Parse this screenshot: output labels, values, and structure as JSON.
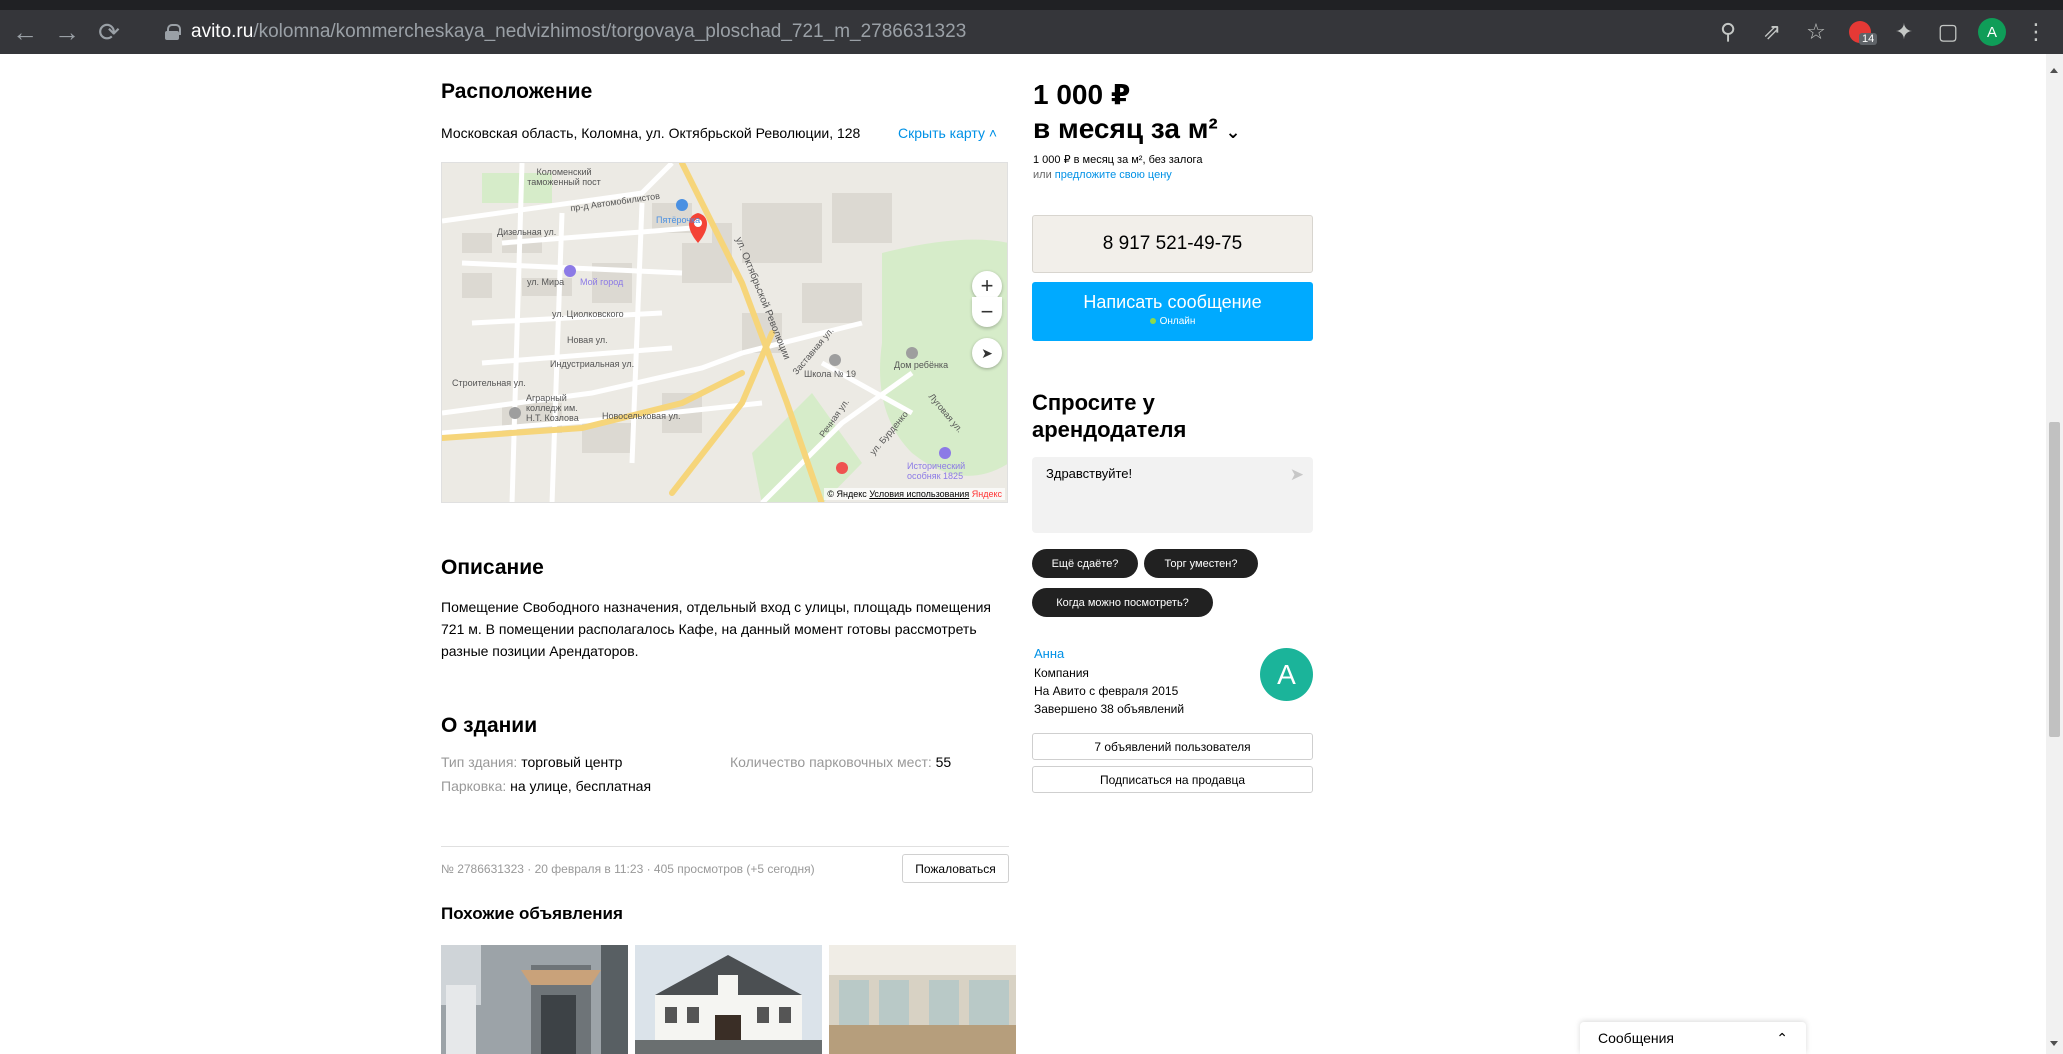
{
  "browser": {
    "url_host": "avito.ru",
    "url_path": "/kolomna/kommercheskaya_nedvizhimost/torgovaya_ploschad_721_m_2786631323",
    "extension_badge": "14",
    "profile_initial": "A"
  },
  "location": {
    "heading": "Расположение",
    "address": "Московская область, Коломна, ул. Октябрьской Революции, 128",
    "hide_map": "Скрыть карту",
    "map_labels": {
      "customs": "Коломенский таможенный пост",
      "pyaterochka": "Пятёрочка",
      "my_city": "Мой город",
      "school": "Школа № 19",
      "children_home": "Дом ребёнка",
      "college": "Аграрный колледж им. Н.Т. Козлова",
      "historic": "Исторический особняк 1825",
      "oct_rev": "ул. Октябрьской Революции",
      "street_mira": "ул. Мира",
      "street_tsiolk": "ул. Циолковского",
      "street_novaya": "Новая ул.",
      "street_industr": "Индустриальная ул.",
      "street_stroit": "Строительная ул.",
      "street_dizel": "Дизельная ул.",
      "street_novosel": "Новосельковая ул.",
      "street_avtomob": "пр-д Автомобилистов",
      "street_zastav": "Заставная ул.",
      "street_rechnaya": "Речная ул.",
      "street_lugov": "Луговая ул.",
      "street_burdenko": "ул. Бурденко"
    },
    "map_copy": "© Яндекс",
    "map_terms": "Условия использования",
    "map_brand": "Яндекс"
  },
  "description": {
    "heading": "Описание",
    "text": "Помещение Свободного назначения, отдельный вход с улицы, площадь помещения 721 м. В помещении располагалось Кафе, на данный момент готовы рассмотреть разные позиции Арендаторов."
  },
  "building": {
    "heading": "О здании",
    "type_key": "Тип здания:",
    "type_val": "торговый центр",
    "parking_count_key": "Количество парковочных мест:",
    "parking_count_val": "55",
    "parking_key": "Парковка:",
    "parking_val": "на улице, бесплатная"
  },
  "meta": {
    "line": "№ 2786631323 · 20 февраля в 11:23 · 405 просмотров (+5 сегодня)",
    "complain": "Пожаловаться"
  },
  "similar": {
    "heading": "Похожие объявления"
  },
  "price": {
    "line1": "1 000 ₽",
    "line2": "в месяц за м²",
    "sub1": "1 000 ₽ в месяц за м², без залога",
    "sub2_prefix": "или",
    "sub2_link": "предложите свою цену"
  },
  "contact": {
    "phone": "8 917 521-49-75",
    "message_btn": "Написать сообщение",
    "online": "Онлайн"
  },
  "ask": {
    "heading": "Спросите у арендодателя",
    "placeholder": "Здравствуйте!",
    "chips": [
      "Ещё сдаёте?",
      "Торг уместен?",
      "Когда можно посмотреть?"
    ]
  },
  "seller": {
    "name": "Анна",
    "type": "Компания",
    "since": "На Авито с февраля 2015",
    "completed": "Завершено 38 объявлений",
    "avatar": "A",
    "listings_btn": "7 объявлений пользователя",
    "subscribe_btn": "Подписаться на продавца"
  },
  "messages_widget": {
    "label": "Сообщения"
  },
  "colors": {
    "accent": "#00aaff",
    "link": "#0091e6",
    "chip": "#212121",
    "avatar": "#1bb49a"
  }
}
